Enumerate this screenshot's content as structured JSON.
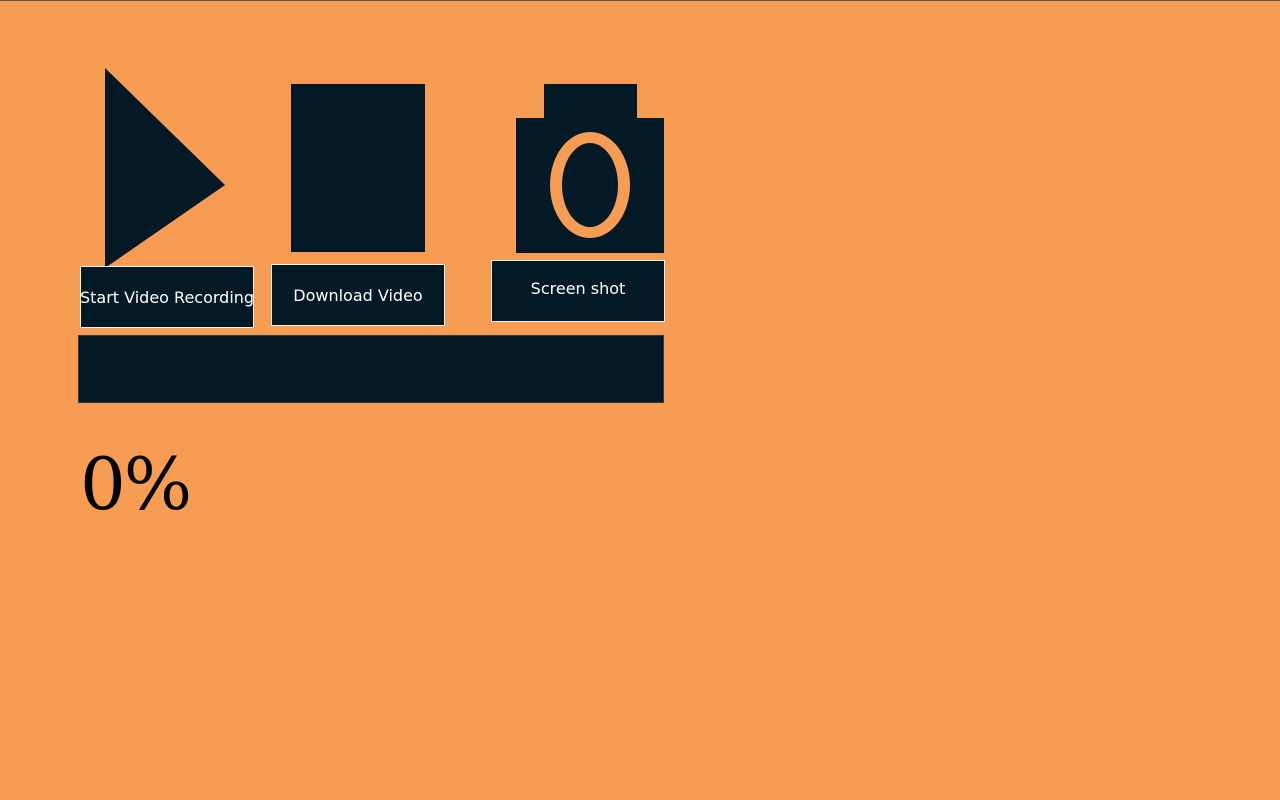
{
  "page": {
    "background_color": "#F79C53",
    "accent_color": "#041926"
  },
  "icons": {
    "play": "play-icon",
    "stop": "stop-icon",
    "camera": "camera-icon"
  },
  "buttons": {
    "start_label": "Start Video Recording",
    "download_label": "Download Video",
    "screenshot_label": "Screen shot"
  },
  "progress": {
    "value": 0,
    "text": "0%"
  }
}
